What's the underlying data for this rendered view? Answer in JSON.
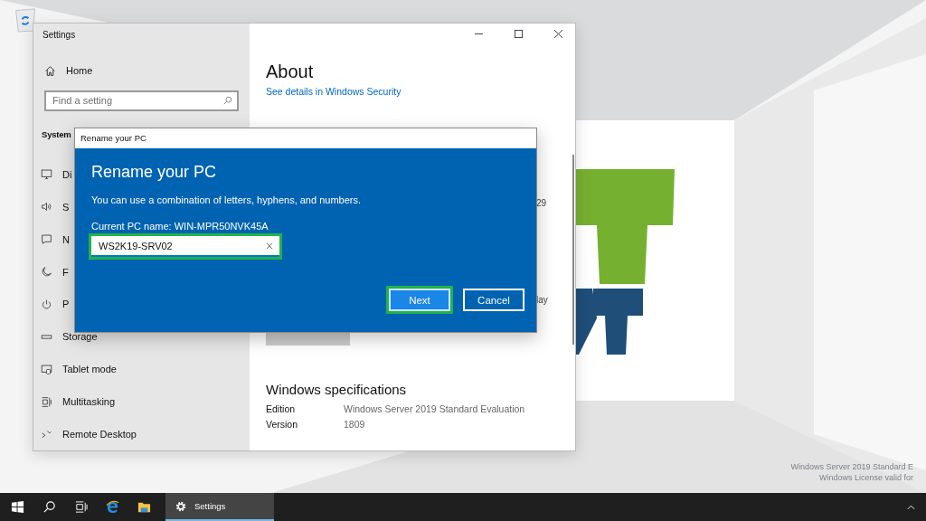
{
  "settings_window": {
    "title": "Settings"
  },
  "sidebar": {
    "home": "Home",
    "search": {
      "placeholder": "Find a setting"
    },
    "section": "System",
    "items": [
      {
        "label": "Di",
        "kind": "display"
      },
      {
        "label": "S",
        "kind": "sound"
      },
      {
        "label": "N",
        "kind": "notifications"
      },
      {
        "label": "F",
        "kind": "focus"
      },
      {
        "label": "P",
        "kind": "power"
      },
      {
        "label": "Storage",
        "kind": "storage"
      },
      {
        "label": "Tablet mode",
        "kind": "tablet"
      },
      {
        "label": "Multitasking",
        "kind": "multitasking"
      },
      {
        "label": "Remote Desktop",
        "kind": "remote"
      }
    ]
  },
  "about": {
    "title": "About",
    "link": "See details in Windows Security",
    "fragment_1": "29",
    "fragment_2": "lay",
    "spec_title": "Windows specifications",
    "specs": [
      {
        "label": "Edition",
        "value": "Windows Server 2019 Standard Evaluation"
      },
      {
        "label": "Version",
        "value": "1809"
      }
    ]
  },
  "dialog": {
    "title": "Rename your PC",
    "heading": "Rename your PC",
    "description": "You can use a combination of letters, hyphens, and numbers.",
    "current_name": "Current PC name: WIN-MPR50NVK45A",
    "input": {
      "value": "WS2K19-SRV02",
      "highlighted": true
    },
    "buttons": [
      {
        "label": "Next",
        "primary": true,
        "highlighted": true
      },
      {
        "label": "Cancel",
        "primary": false,
        "highlighted": false
      }
    ]
  },
  "desktop_text": [
    "Windows Server 2019 Standard E",
    "Windows License valid for"
  ],
  "taskbar": {
    "apps": [
      {
        "kind": "edge"
      },
      {
        "kind": "explorer"
      },
      {
        "kind": "settings",
        "label": "Settings",
        "active": true
      }
    ]
  }
}
